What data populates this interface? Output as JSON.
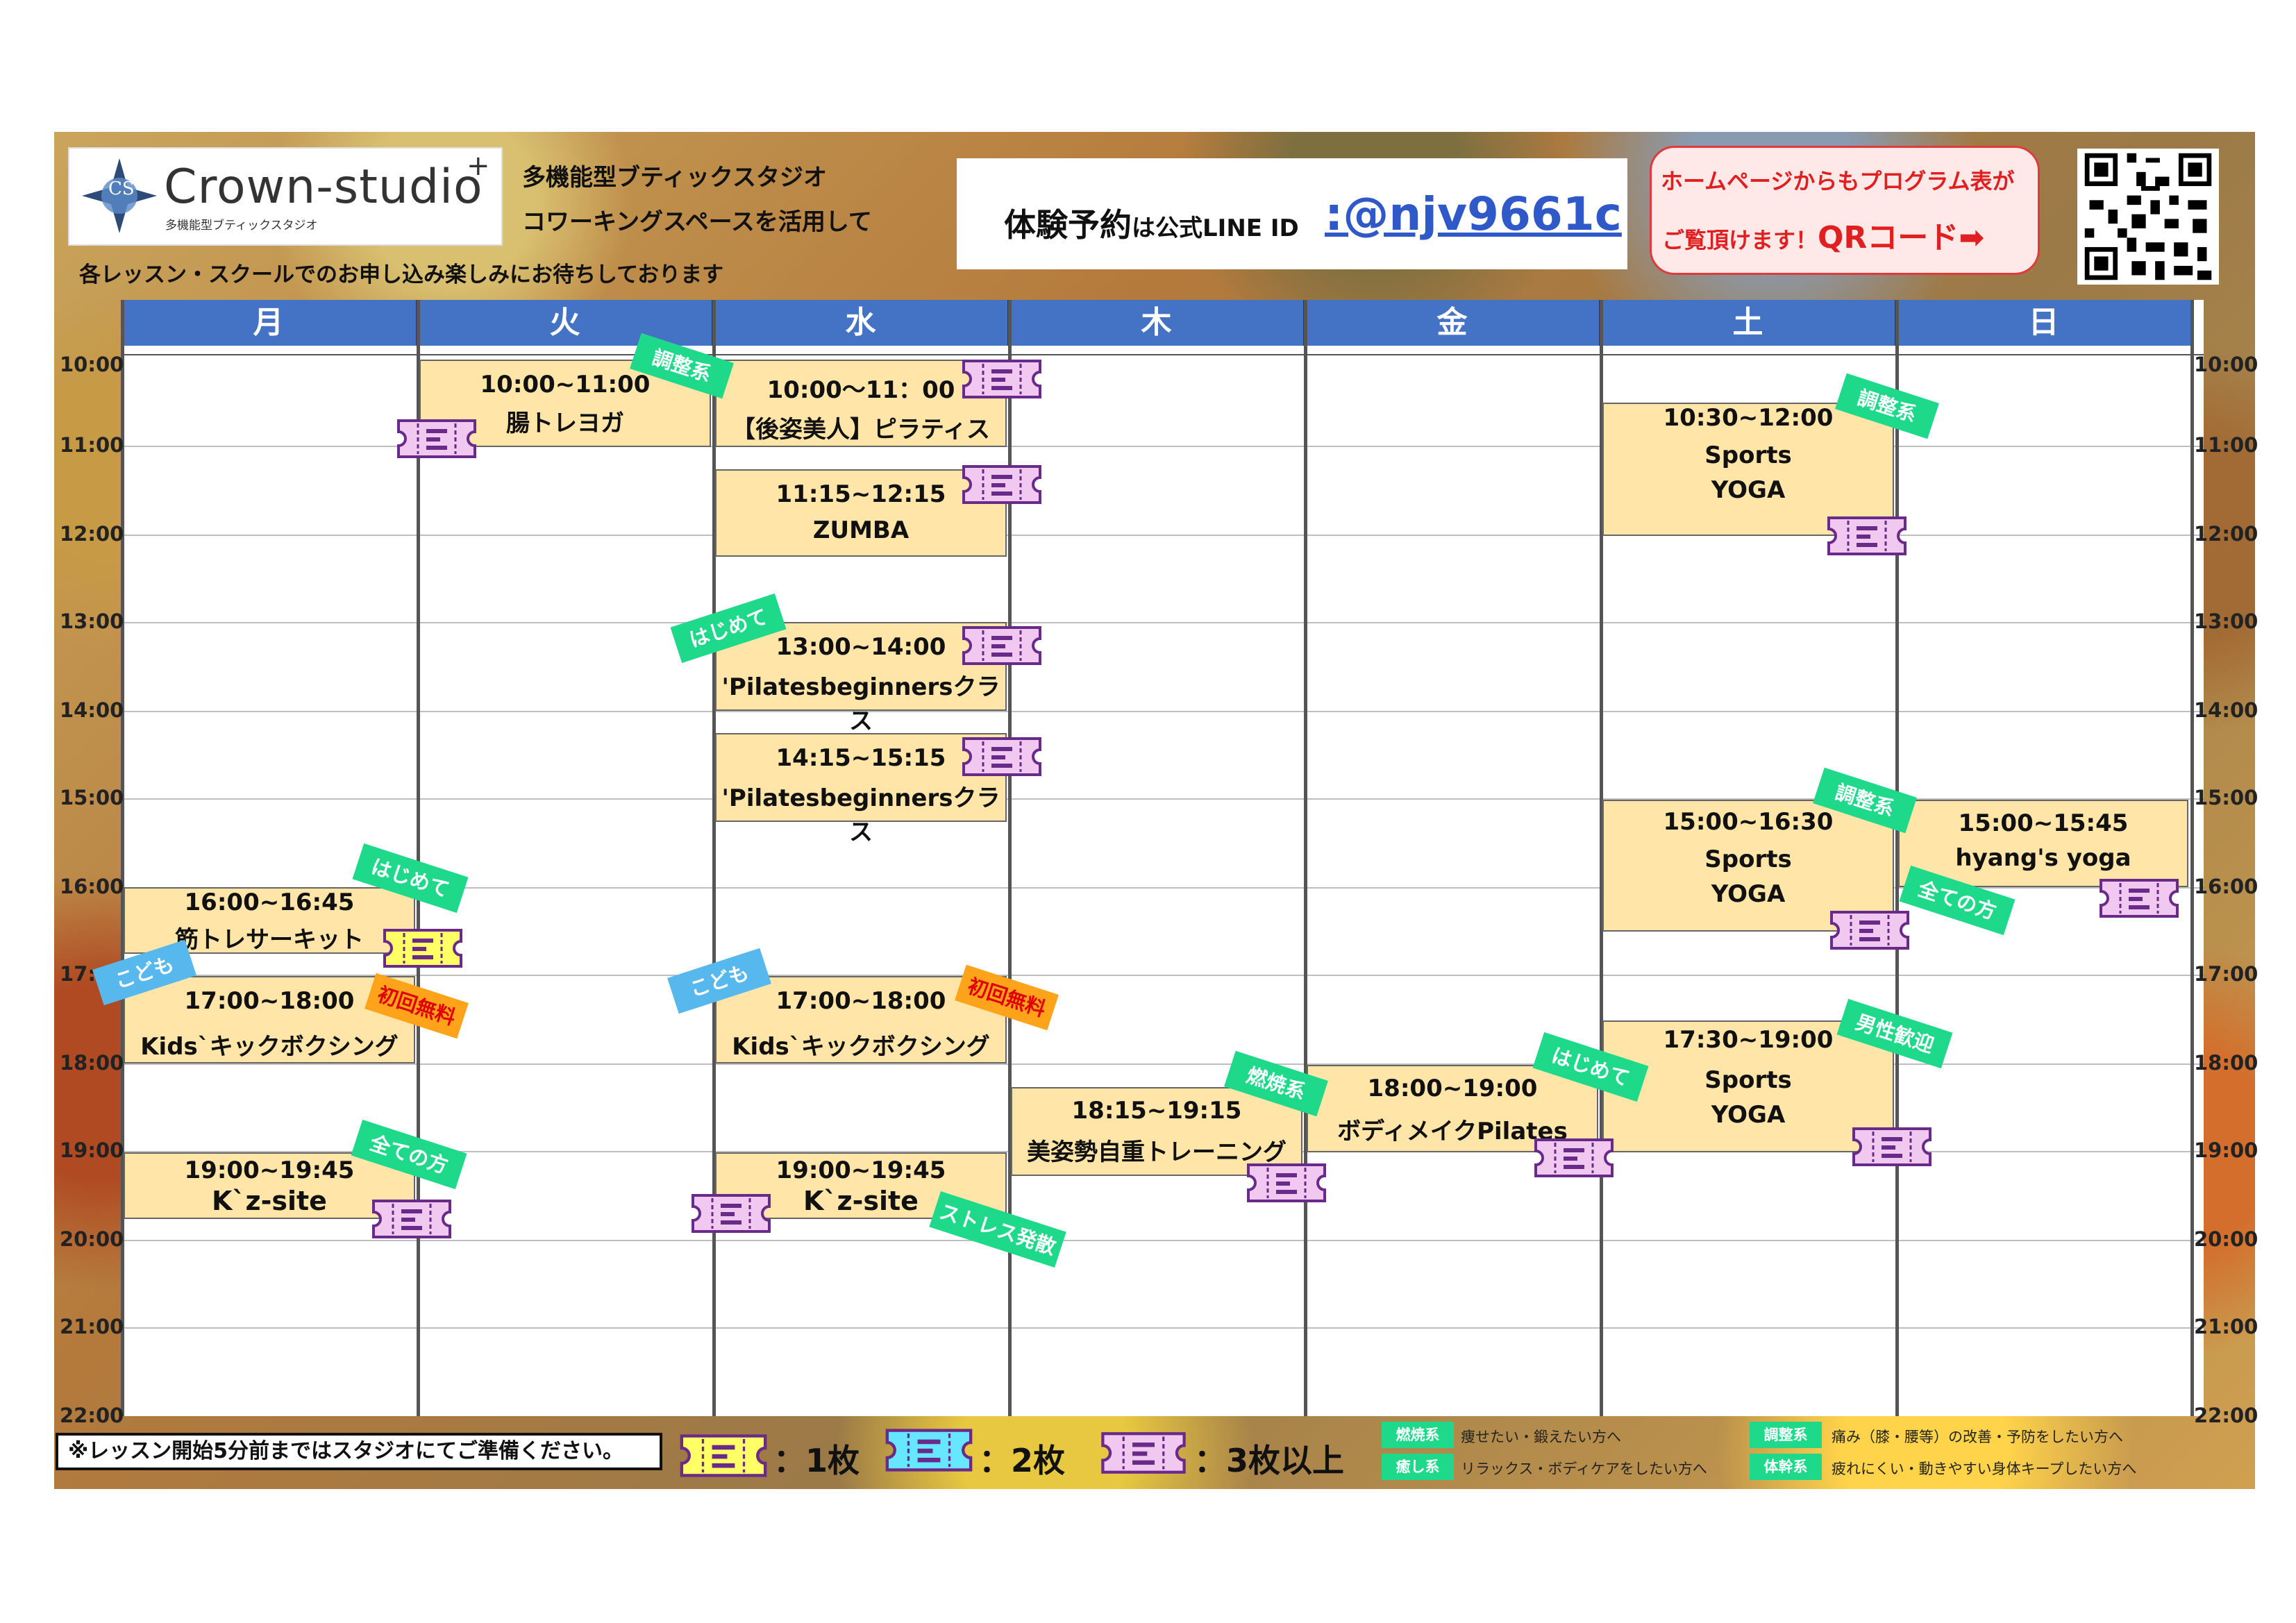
{
  "logo": {
    "name": "Crown-studio",
    "plus": "+",
    "subtitle": "多機能型ブティックスタジオ",
    "mark": "CS"
  },
  "tagline": {
    "line1": "多機能型ブティックスタジオ",
    "line2": "コワーキングスペースを活用して"
  },
  "sub_tagline": "各レッスン・スクールでのお申し込み楽しみにお待ちしております",
  "line": {
    "label_a": "体験予約",
    "label_b": "は公式LINE ID",
    "id": ":@njv9661c"
  },
  "homepage": {
    "line1": "ホームページからもプログラム表が",
    "line2a": "ご覧頂けます！",
    "line2b": "QRコード",
    "arrow": "➡"
  },
  "days": [
    "月",
    "火",
    "水",
    "木",
    "金",
    "土",
    "日"
  ],
  "times": [
    "10:00",
    "11:00",
    "12:00",
    "13:00",
    "14:00",
    "15:00",
    "16:00",
    "17:00",
    "18:00",
    "19:00",
    "20:00",
    "21:00",
    "22:00"
  ],
  "left_time_17": "17:",
  "events": [
    {
      "time": "10:00~11:00",
      "name": "腸トレヨガ"
    },
    {
      "time": "10:00～11：00",
      "name": "【後姿美人】ピラティス"
    },
    {
      "time": "11:15~12:15",
      "name": "ZUMBA"
    },
    {
      "time": "13:00~14:00",
      "name": "'Pilatesbeginnersクラス"
    },
    {
      "time": "14:15~15:15",
      "name": "'Pilatesbeginnersクラス"
    },
    {
      "time": "10:30~12:00",
      "name": "Sports",
      "name2": "YOGA"
    },
    {
      "time": "15:00~16:30",
      "name": "Sports",
      "name2": "YOGA"
    },
    {
      "time": "15:00~15:45",
      "name": "hyang's yoga"
    },
    {
      "time": "16:00~16:45",
      "name": "筋トレサーキット"
    },
    {
      "time": "17:00~18:00",
      "name": "Kids`キックボクシング"
    },
    {
      "time": "17:00~18:00",
      "name": "Kids`キックボクシング"
    },
    {
      "time": "19:00~19:45",
      "name": "K`z-site"
    },
    {
      "time": "19:00~19:45",
      "name": "K`z-site"
    },
    {
      "time": "18:15~19:15",
      "name": "美姿勢自重トレーニング"
    },
    {
      "time": "18:00~19:00",
      "name": "ボディメイクPilates"
    },
    {
      "time": "17:30~19:00",
      "name": "Sports",
      "name2": "YOGA"
    }
  ],
  "tags": {
    "chosei": "調整系",
    "hajimete": "はじめて",
    "kodomo": "こども",
    "shokai": "初回無料",
    "subete": "全ての方",
    "nensho": "燃焼系",
    "stress": "ストレス発散",
    "dansei": "男性歓迎"
  },
  "footer": {
    "note": "※レッスン開始5分前まではスタジオにてご準備ください。",
    "ticket1": "：1枚",
    "ticket2": "：2枚",
    "ticket3": "：3枚以上"
  },
  "categories": [
    {
      "label": "燃焼系",
      "desc": "痩せたい・鍛えたい方へ"
    },
    {
      "label": "癒し系",
      "desc": "リラックス・ボディケアをしたい方へ"
    },
    {
      "label": "調整系",
      "desc": "痛み（膝・腰等）の改善・予防をしたい方へ"
    },
    {
      "label": "体幹系",
      "desc": "疲れにくい・動きやすい身体キープしたい方へ"
    }
  ],
  "colors": {
    "header_blue": "#4472c4",
    "event_fill": "#ffe6a8",
    "tag_green": "#1fd98a",
    "tag_blue": "#57b8ee",
    "tag_orange": "#ffa31a",
    "ticket_yellow": "#ffff66",
    "ticket_cyan": "#66e6ff",
    "ticket_purple": "#f0c8f0",
    "line_blue": "#2f59c8",
    "hp_red": "#e02020"
  }
}
